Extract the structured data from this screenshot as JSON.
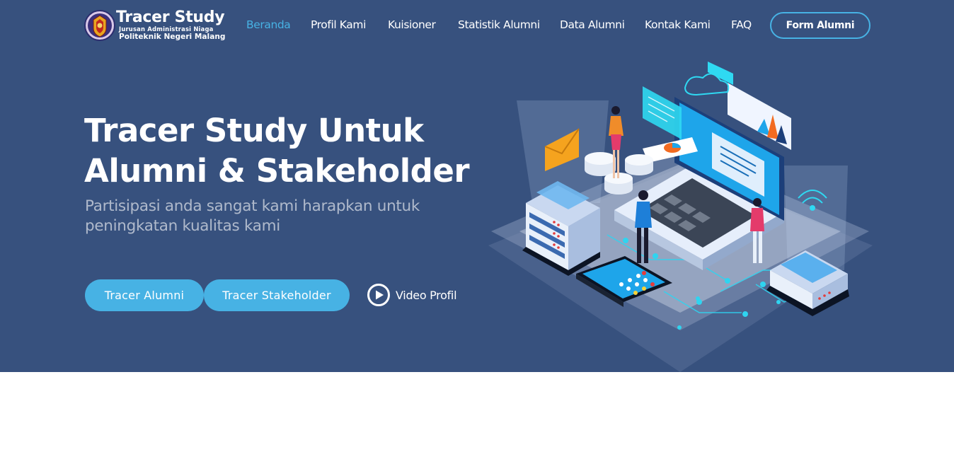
{
  "header": {
    "logo": {
      "title": "Tracer Study",
      "subtitle_1": "Jurusan Administrasi Niaga",
      "subtitle_2": "Politeknik Negeri Malang"
    },
    "nav": [
      {
        "label": "Beranda",
        "active": true
      },
      {
        "label": "Profil Kami",
        "active": false
      },
      {
        "label": "Kuisioner",
        "active": false
      },
      {
        "label": "Statistik Alumni",
        "active": false
      },
      {
        "label": "Data Alumni",
        "active": false
      },
      {
        "label": "Kontak Kami",
        "active": false
      },
      {
        "label": "FAQ",
        "active": false
      }
    ],
    "cta_label": "Form Alumni"
  },
  "hero": {
    "title": "Tracer Study Untuk Alumni & Stakeholder",
    "subtitle": "Partisipasi anda sangat kami harapkan untuk peningkatan kualitas kami",
    "buttons": {
      "alumni": "Tracer Alumni",
      "stakeholder": "Tracer Stakeholder"
    },
    "video_label": "Video Profil"
  },
  "colors": {
    "hero_bg": "#37517e",
    "accent": "#47b2e4",
    "text": "#ffffff"
  },
  "icons": {
    "logo": "university-emblem-icon",
    "video": "play-circle-icon"
  }
}
